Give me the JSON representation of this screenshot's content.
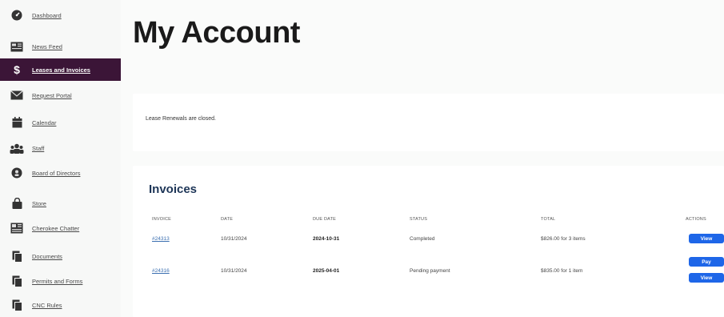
{
  "sidebar": {
    "items": [
      {
        "label": "Dashboard",
        "icon": "dashboard-icon",
        "active": false
      },
      {
        "label": "News Feed",
        "icon": "news-feed-icon",
        "active": false
      },
      {
        "label": "Leases and Invoices",
        "icon": "dollar-icon",
        "active": true
      },
      {
        "label": "Request Portal",
        "icon": "envelope-icon",
        "active": false
      },
      {
        "label": "Calendar",
        "icon": "calendar-icon",
        "active": false
      },
      {
        "label": "Staff",
        "icon": "staff-icon",
        "active": false
      },
      {
        "label": "Board of Directors",
        "icon": "board-icon",
        "active": false
      },
      {
        "label": "Store",
        "icon": "store-bag-icon",
        "active": false
      },
      {
        "label": "Cherokee Chatter",
        "icon": "newspaper-icon",
        "active": false
      },
      {
        "label": "Documents",
        "icon": "documents-icon",
        "active": false
      },
      {
        "label": "Permits and Forms",
        "icon": "forms-icon",
        "active": false
      },
      {
        "label": "CNC Rules",
        "icon": "rules-icon",
        "active": false
      }
    ]
  },
  "main": {
    "title": "My Account",
    "notice": "Lease Renewals are closed.",
    "invoices": {
      "title": "Invoices",
      "columns": [
        "INVOICE",
        "DATE",
        "DUE DATE",
        "STATUS",
        "TOTAL",
        "ACTIONS"
      ],
      "rows": [
        {
          "invoice": "#24313",
          "date": "10/31/2024",
          "due_date": "2024-10-31",
          "status": "Completed",
          "total": "$826.00 for 3 items",
          "actions": [
            "View"
          ]
        },
        {
          "invoice": "#24316",
          "date": "10/31/2024",
          "due_date": "2025-04-01",
          "status": "Pending payment",
          "total": "$835.00 for 1 item",
          "actions": [
            "Pay",
            "View"
          ]
        }
      ]
    }
  },
  "colors": {
    "sidebar_active": "#3b1537",
    "button": "#1e66e8",
    "invoices_title": "#1d3557",
    "link": "#3b6fb0"
  }
}
